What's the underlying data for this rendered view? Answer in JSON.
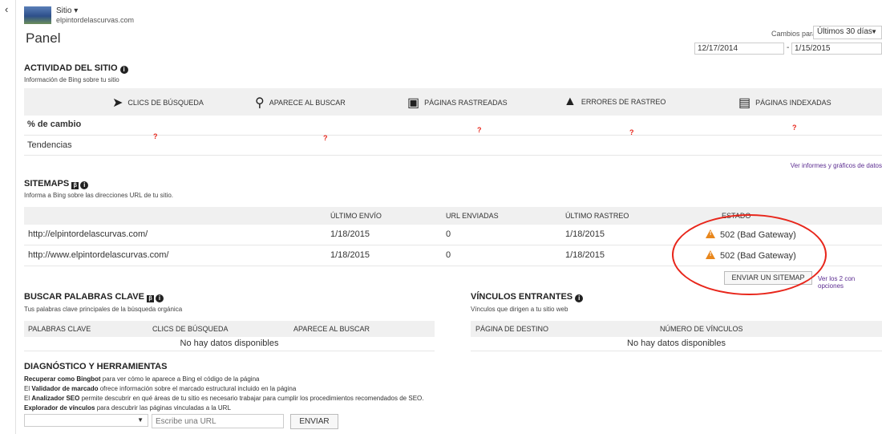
{
  "site": {
    "label": "Sitio ▾",
    "url": "elpintordelascurvas.com"
  },
  "page_title": "Panel",
  "date_range": {
    "label": "Cambios para",
    "selected": "Últimos 30 días",
    "from": "12/17/2014",
    "separator": "-",
    "to": "1/15/2015"
  },
  "actividad": {
    "title": "ACTIVIDAD DEL SITIO",
    "subtitle": "Información de Bing sobre tu sitio",
    "metrics": [
      {
        "label": "CLICS DE BÚSQUEDA",
        "icon": "cursor-icon"
      },
      {
        "label": "APARECE AL BUSCAR",
        "icon": "search-icon"
      },
      {
        "label": "PÁGINAS RASTREADAS",
        "icon": "robot-icon"
      },
      {
        "label": "ERRORES DE RASTREO",
        "icon": "error-icon"
      },
      {
        "label": "PÁGINAS INDEXADAS",
        "icon": "document-icon"
      }
    ],
    "row_change": "% de cambio",
    "row_trend": "Tendencias",
    "unknown_mark": "?",
    "more_link": "Ver informes y gráficos de datos"
  },
  "sitemaps": {
    "title": "SITEMAPS",
    "subtitle": "Informa a Bing sobre las direcciones URL de tu sitio.",
    "columns": [
      "ÚLTIMO ENVÍO",
      "URL ENVIADAS",
      "ÚLTIMO RASTREO",
      "ESTADO"
    ],
    "rows": [
      {
        "url": "http://elpintordelascurvas.com/",
        "last_sent": "1/18/2015",
        "urls": "0",
        "last_crawl": "1/18/2015",
        "status": "502 (Bad Gateway)"
      },
      {
        "url": "http://www.elpintordelascurvas.com/",
        "last_sent": "1/18/2015",
        "urls": "0",
        "last_crawl": "1/18/2015",
        "status": "502 (Bad Gateway)"
      }
    ],
    "submit_button": "ENVIAR UN SITEMAP",
    "options_link": "Ver los 2 con opciones"
  },
  "keywords": {
    "title": "BUSCAR PALABRAS CLAVE",
    "subtitle": "Tus palabras clave principales de la búsqueda orgánica",
    "columns": [
      "PALABRAS CLAVE",
      "CLICS DE BÚSQUEDA",
      "APARECE AL BUSCAR"
    ],
    "empty": "No hay datos disponibles"
  },
  "inbound": {
    "title": "VÍNCULOS ENTRANTES",
    "subtitle": "Vínculos que dirigen a tu sitio web",
    "columns": [
      "PÁGINA DE DESTINO",
      "NÚMERO DE VÍNCULOS"
    ],
    "empty": "No hay datos disponibles"
  },
  "diagnostics": {
    "title": "DIAGNÓSTICO Y HERRAMIENTAS",
    "lines": [
      {
        "bold": "Recuperar como Bingbot",
        "rest": " para ver cómo le aparece a Bing el código de la página",
        "prefix": ""
      },
      {
        "bold": "Validador de marcado",
        "rest": " ofrece información sobre el marcado estructural incluido en la página",
        "prefix": "El "
      },
      {
        "bold": "Analizador SEO",
        "rest": " permite descubrir en qué áreas de tu sitio es necesario trabajar para cumplir los procedimientos recomendados de SEO.",
        "prefix": "El "
      },
      {
        "bold": "Explorador de vínculos",
        "rest": " para descubrir las páginas vinculadas a la URL",
        "prefix": ""
      }
    ],
    "url_placeholder": "Escribe una URL",
    "send_button": "ENVIAR"
  }
}
